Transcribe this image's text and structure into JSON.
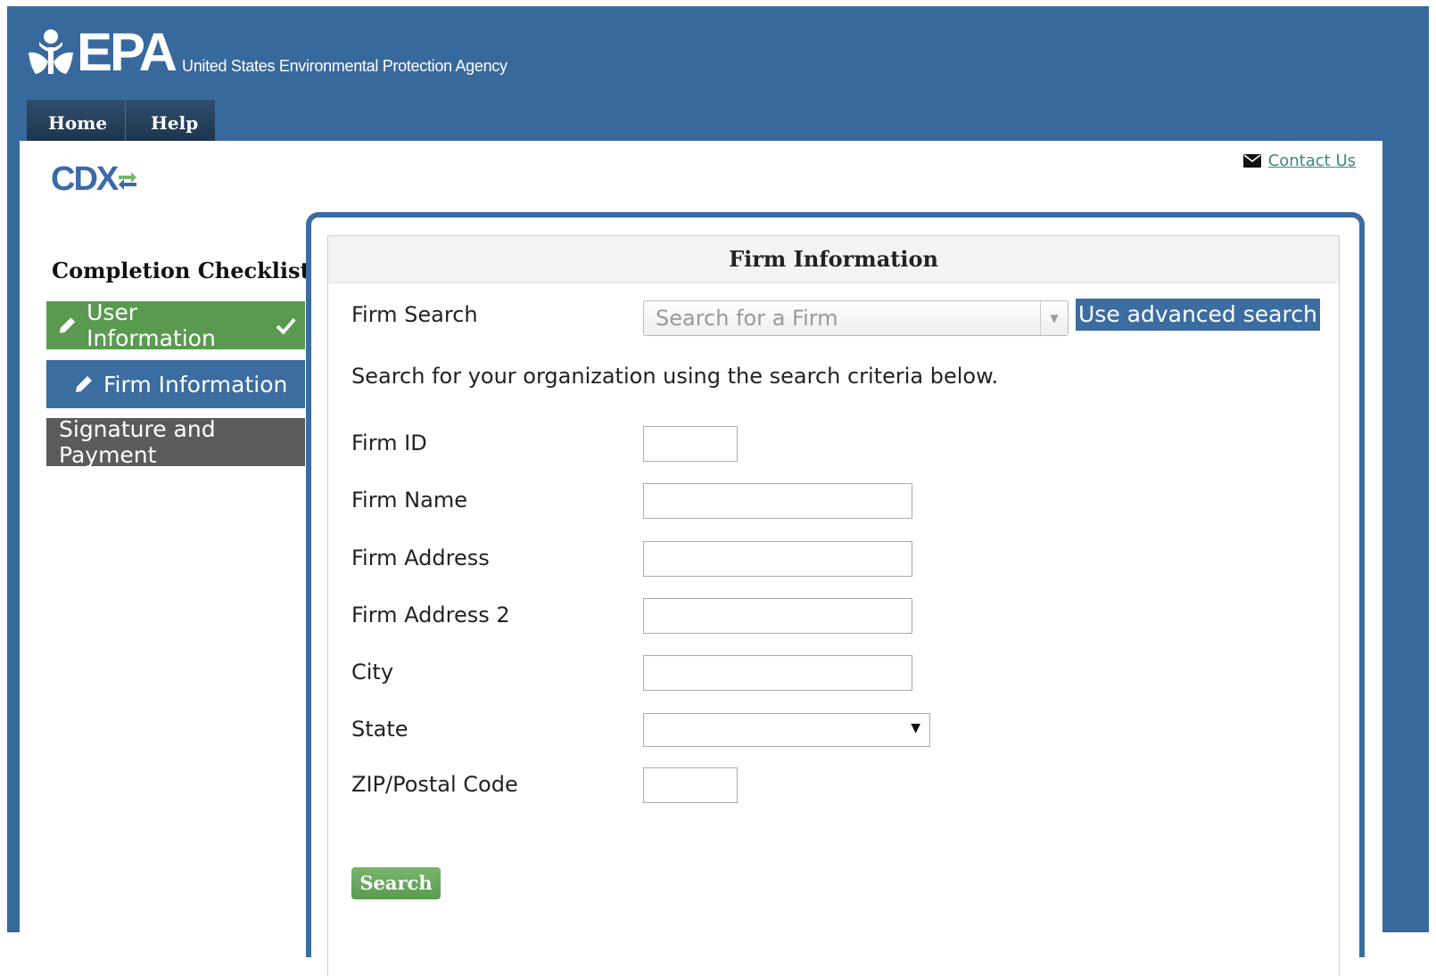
{
  "header": {
    "logo_text": "EPA",
    "agency_name": "United States Environmental Protection Agency",
    "nav": [
      {
        "label": "Home"
      },
      {
        "label": "Help"
      }
    ]
  },
  "cdx": {
    "logo_text": "CDX"
  },
  "contact": {
    "label": "Contact Us"
  },
  "checklist": {
    "title": "Completion Checklist",
    "steps": [
      {
        "label": "User Information",
        "status": "complete"
      },
      {
        "label": "Firm Information",
        "status": "active"
      },
      {
        "label": "Signature and Payment",
        "status": "pending"
      }
    ]
  },
  "panel": {
    "title": "Firm Information",
    "firm_search_label": "Firm Search",
    "firm_search_placeholder": "Search for a Firm",
    "advanced_search_label": "Use advanced search",
    "hint": "Search for your organization using the search criteria below.",
    "fields": {
      "firm_id": "Firm ID",
      "firm_name": "Firm Name",
      "firm_address": "Firm Address",
      "firm_address_2": "Firm Address 2",
      "city": "City",
      "state": "State",
      "zip": "ZIP/Postal Code"
    },
    "search_button": "Search"
  },
  "colors": {
    "brand_blue": "#38699d",
    "nav_dark": "#1b3148",
    "complete_green": "#5a9a50",
    "active_blue": "#3b6da0",
    "pending_gray": "#5b5b5b"
  }
}
